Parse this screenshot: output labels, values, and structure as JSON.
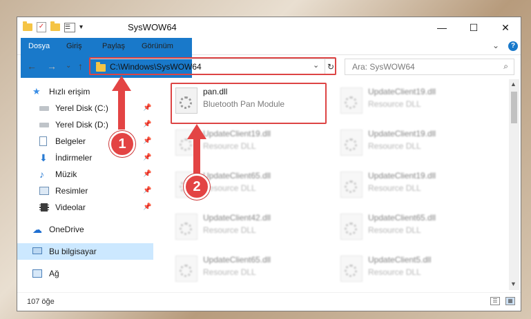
{
  "window": {
    "title": "SysWOW64",
    "qat_dropdown": "▾",
    "controls": {
      "minimize": "—",
      "maximize": "☐",
      "close": "✕"
    }
  },
  "ribbon": {
    "tabs": [
      "Dosya",
      "Giriş",
      "Paylaş",
      "Görünüm"
    ],
    "expand": "⌄",
    "help": "?"
  },
  "nav_buttons": {
    "back": "←",
    "forward": "→",
    "recent": "⌄",
    "up": "↑"
  },
  "address": {
    "path": "C:\\Windows\\SysWOW64",
    "dropdown": "⌄",
    "refresh": "↻"
  },
  "search": {
    "placeholder": "Ara: SysWOW64",
    "icon": "⌕"
  },
  "sidebar": {
    "items": [
      {
        "label": "Hızlı erişim",
        "icon": "star-icon",
        "pinned": false
      },
      {
        "label": "Yerel Disk (C:)",
        "icon": "drive-icon",
        "pinned": true
      },
      {
        "label": "Yerel Disk (D:)",
        "icon": "drive-icon",
        "pinned": true
      },
      {
        "label": "Belgeler",
        "icon": "documents-icon",
        "pinned": true
      },
      {
        "label": "İndirmeler",
        "icon": "download-icon",
        "pinned": true
      },
      {
        "label": "Müzik",
        "icon": "music-icon",
        "pinned": true
      },
      {
        "label": "Resimler",
        "icon": "pictures-icon",
        "pinned": true
      },
      {
        "label": "Videolar",
        "icon": "videos-icon",
        "pinned": true
      },
      {
        "label": "OneDrive",
        "icon": "cloud-icon",
        "pinned": false
      },
      {
        "label": "Bu bilgisayar",
        "icon": "computer-icon",
        "pinned": false
      },
      {
        "label": "Ağ",
        "icon": "network-icon",
        "pinned": false
      }
    ],
    "pin_glyph": "📌"
  },
  "files": [
    {
      "name": "pan.dll",
      "description": "Bluetooth Pan Module"
    },
    {
      "name": "UpdateClient19.dll",
      "description": "Resource DLL"
    },
    {
      "name": "UpdateClient19.dll",
      "description": "Resource DLL"
    },
    {
      "name": "UpdateClient19.dll",
      "description": "Resource DLL"
    },
    {
      "name": "UpdateClient65.dll",
      "description": "Resource DLL"
    },
    {
      "name": "UpdateClient19.dll",
      "description": "Resource DLL"
    },
    {
      "name": "UpdateClient42.dll",
      "description": "Resource DLL"
    },
    {
      "name": "UpdateClient65.dll",
      "description": "Resource DLL"
    },
    {
      "name": "UpdateClient65.dll",
      "description": "Resource DLL"
    },
    {
      "name": "UpdateClient5.dll",
      "description": "Resource DLL"
    }
  ],
  "annotations": {
    "step1": "1",
    "step2": "2",
    "color": "#e34444"
  },
  "status": {
    "count": "107 öğe"
  },
  "scrollbar": {
    "up": "▲",
    "down": "▼"
  }
}
